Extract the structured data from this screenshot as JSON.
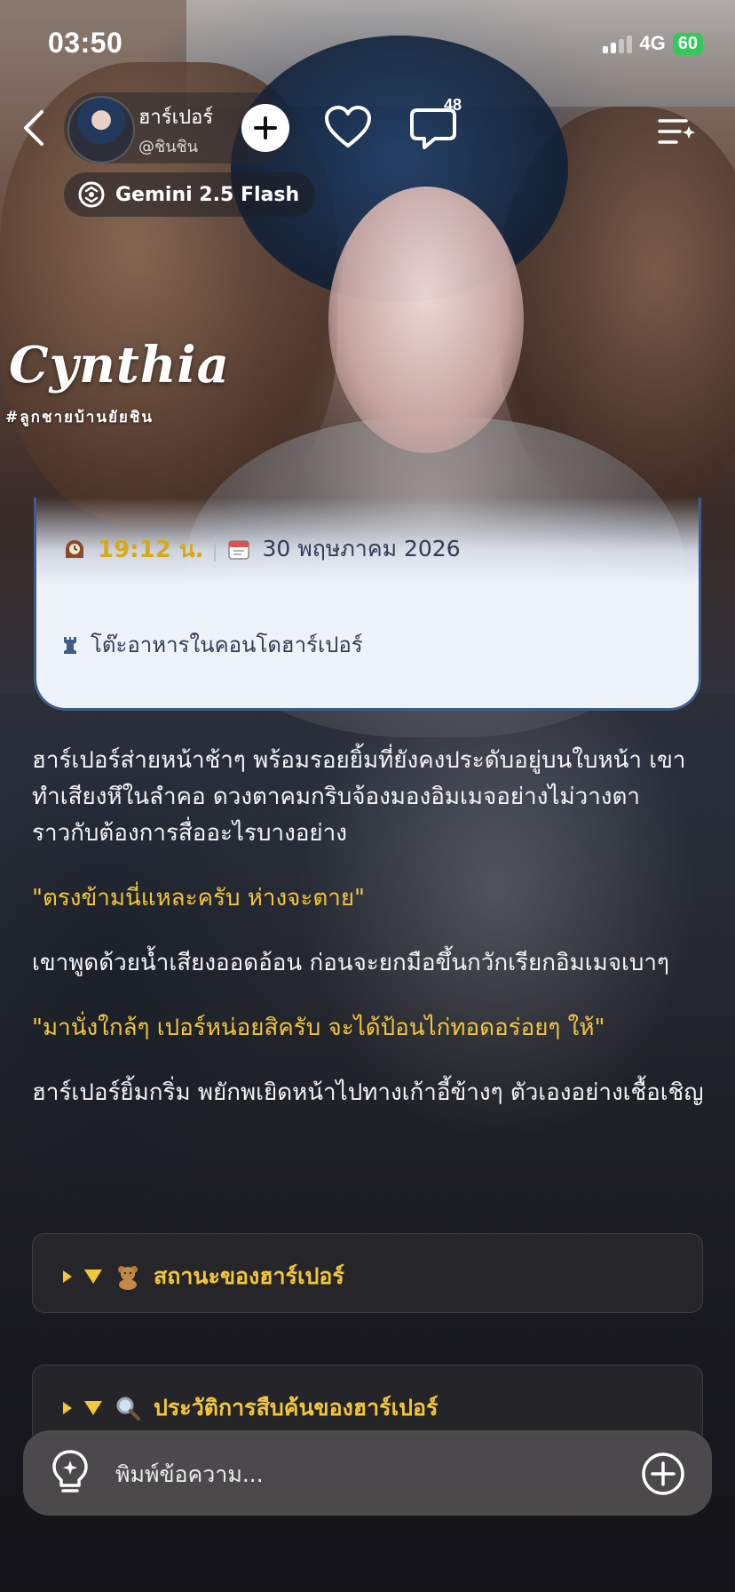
{
  "status_bar": {
    "time": "03:50",
    "network": "4G",
    "battery": "60"
  },
  "header": {
    "character_name": "ฮาร์เปอร์",
    "creator_handle": "@ชินชิน",
    "comment_count": "48",
    "model_label": "Gemini 2.5 Flash"
  },
  "logo": {
    "title": "Cynthia",
    "tagline": "#ลูกชายบ้านยัยชิน"
  },
  "info_card": {
    "time": "19:12 น.",
    "date": "30 พฤษภาคม 2026",
    "location": "โต๊ะอาหารในคอนโดฮาร์เปอร์"
  },
  "story": {
    "para1": "ฮาร์เปอร์ส่ายหน้าช้าๆ พร้อมรอยยิ้มที่ยังคงประดับอยู่บนใบหน้า เขาทำเสียงหึในลำคอ ดวงตาคมกริบจ้องมองอิมเมจอย่างไม่วางตา ราวกับต้องการสื่ออะไรบางอย่าง",
    "quote1": "\"ตรงข้ามนี่แหละครับ ห่างจะตาย\"",
    "para2": "เขาพูดด้วยน้ำเสียงออดอ้อน ก่อนจะยกมือขึ้นกวักเรียกอิมเมจเบาๆ",
    "quote2": "\"มานั่งใกล้ๆ เปอร์หน่อยสิครับ จะได้ป้อนไก่ทอดอร่อยๆ ให้\"",
    "para3": "ฮาร์เปอร์ยิ้มกริ่ม พยักพเยิดหน้าไปทางเก้าอี้ข้างๆ ตัวเองอย่างเชื้อเชิญ"
  },
  "panels": [
    {
      "title": "สถานะของฮาร์เปอร์",
      "icon": "teddy-bear-icon"
    },
    {
      "title": "ประวัติการสืบค้นของฮาร์เปอร์",
      "icon": "magnifier-icon"
    }
  ],
  "composer": {
    "placeholder": "พิมพ์ข้อความ..."
  },
  "colors": {
    "accent_yellow": "#f3c63b",
    "accent_cyan": "#45d4e6",
    "time_gold": "#d6a91a",
    "card_border": "#3e5c8a"
  }
}
